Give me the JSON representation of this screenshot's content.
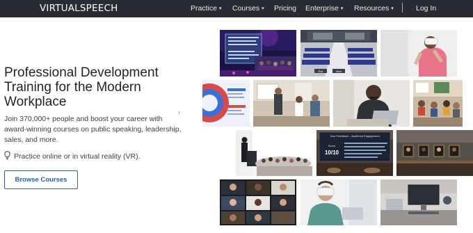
{
  "nav": {
    "logo": "VIRTUALSPEECH",
    "items": [
      {
        "label": "Practice",
        "has_menu": true
      },
      {
        "label": "Courses",
        "has_menu": true
      },
      {
        "label": "Pricing",
        "has_menu": false
      },
      {
        "label": "Enterprise",
        "has_menu": true
      },
      {
        "label": "Resources",
        "has_menu": true
      }
    ],
    "separator": "|",
    "login": "Log In",
    "caret": "▾"
  },
  "hero": {
    "title": "Professional Development Training for the Modern Workplace",
    "description": "Join 370,000+ people and boost your career with award-winning courses on public speaking, leadership, sales, and more.",
    "vr_note": "Practice online or in virtual reality (VR).",
    "vr_icon": "lightbulb-icon",
    "cta": "Browse Courses"
  },
  "collage": {
    "score_panel": {
      "header": "Your Feedback – Audience Engagement",
      "label": "Score",
      "score": "10/10"
    },
    "vr_buttons": [
      "Exit",
      "Next"
    ]
  },
  "colors": {
    "nav_bg": "#282c33",
    "accent": "#2a63a3",
    "heading": "#1f2328",
    "body_text": "#3c4047"
  }
}
